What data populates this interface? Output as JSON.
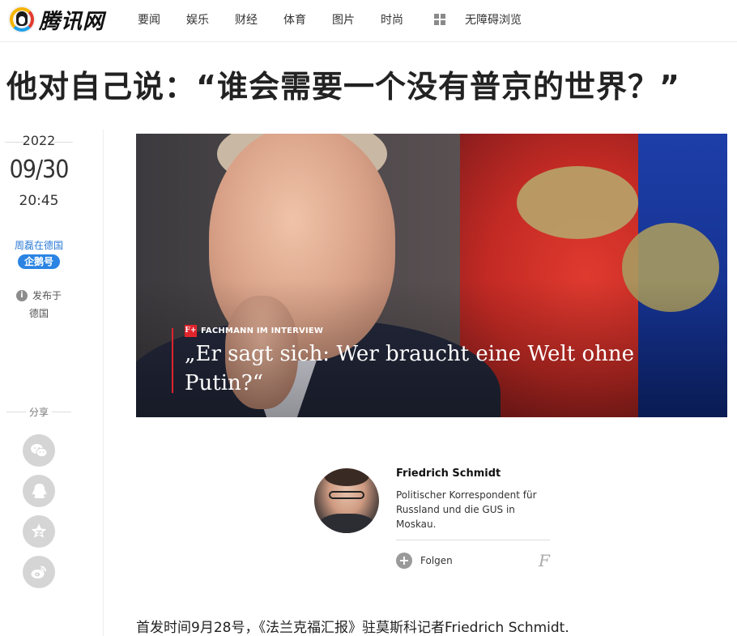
{
  "header": {
    "logo_text": "腾讯网",
    "nav": [
      "要闻",
      "娱乐",
      "财经",
      "体育",
      "图片",
      "时尚"
    ],
    "accessibility": "无障碍浏览"
  },
  "article": {
    "title": "他对自己说：“谁会需要一个没有普京的世界？”",
    "date_year": "2022",
    "date_md": "09/30",
    "date_time": "20:45",
    "author": "周磊在德国",
    "author_badge": "企鹅号",
    "published_label": "发布于",
    "published_location": "德国",
    "share_label": "分享",
    "lead": "首发时间9月28号，《法兰克福汇报》驻莫斯科记者Friedrich Schmidt."
  },
  "hero": {
    "kicker_logo": "F+",
    "kicker": "FACHMANN IM INTERVIEW",
    "headline": "„Er sagt sich: Wer braucht eine Welt ohne Putin?“"
  },
  "author_card": {
    "name": "Friedrich Schmidt",
    "description": "Politischer Korrespondent für Russland und die GUS in Moskau.",
    "follow": "Folgen",
    "brand_mark": "F"
  },
  "share_buttons": [
    "wechat-icon",
    "qq-icon",
    "qzone-icon",
    "weibo-icon"
  ],
  "colors": {
    "accent_blue": "#2b84e3",
    "hero_rule": "#e0242d"
  }
}
